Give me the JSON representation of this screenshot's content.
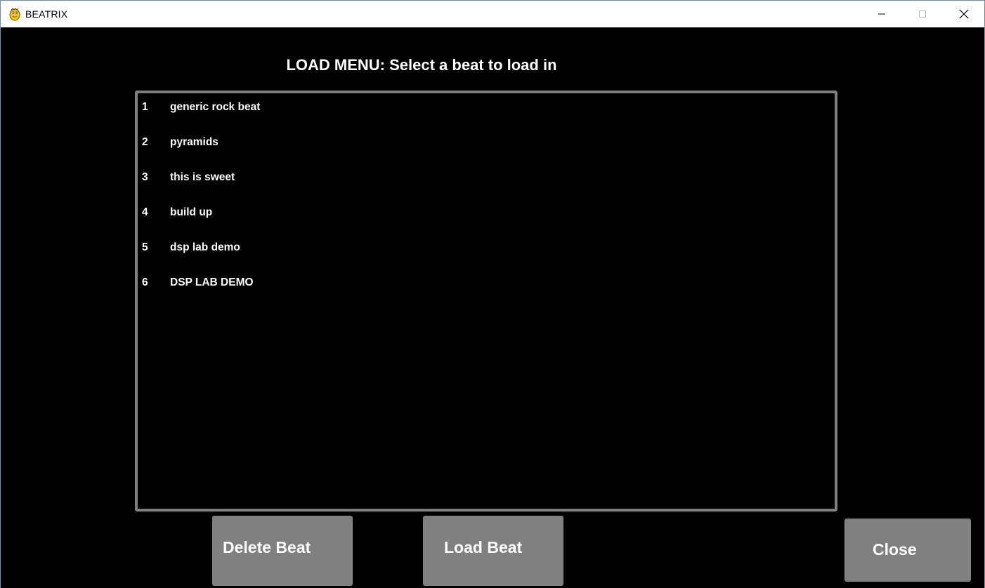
{
  "window": {
    "title": "BEATRIX",
    "controls": [
      "minimize",
      "maximize",
      "close"
    ]
  },
  "heading": "LOAD MENU: Select a beat to load in",
  "beats": [
    {
      "number": "1",
      "name": "generic rock beat"
    },
    {
      "number": "2",
      "name": "pyramids"
    },
    {
      "number": "3",
      "name": "this is sweet"
    },
    {
      "number": "4",
      "name": "build up"
    },
    {
      "number": "5",
      "name": "dsp lab demo"
    },
    {
      "number": "6",
      "name": "DSP LAB DEMO"
    }
  ],
  "buttons": {
    "delete": "Delete Beat",
    "load": "Load Beat",
    "close": "Close"
  },
  "colors": {
    "background": "#000000",
    "button": "#808080",
    "list_border": "#7f7f7f",
    "text": "#ffffff"
  }
}
